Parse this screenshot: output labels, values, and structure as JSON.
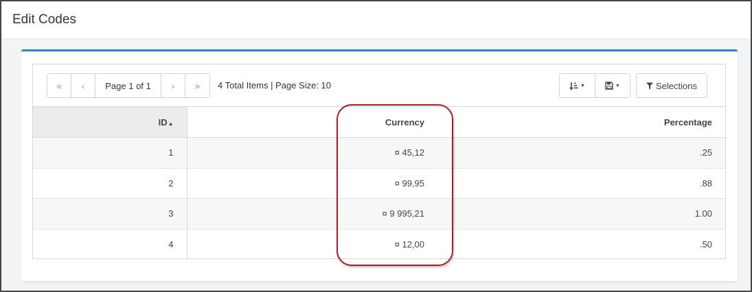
{
  "page": {
    "title": "Edit Codes"
  },
  "pager": {
    "first_icon": "«",
    "prev_icon": "‹",
    "info": "Page 1 of 1",
    "next_icon": "›",
    "last_icon": "»",
    "summary": "4 Total Items | Page Size: 10"
  },
  "toolbar": {
    "sort_icon": "sort-amount-icon",
    "save_icon": "floppy-disk-icon",
    "selections_label": "Selections",
    "selections_icon": "filter-icon"
  },
  "table": {
    "columns": [
      "ID",
      "Currency",
      "Percentage"
    ],
    "sorted_column": "ID",
    "sort_direction": "ascending",
    "rows": [
      {
        "id": "1",
        "currency": "¤ 45,12",
        "percentage": ".25"
      },
      {
        "id": "2",
        "currency": "¤ 99,95",
        "percentage": ".88"
      },
      {
        "id": "3",
        "currency": "¤ 9 995,21",
        "percentage": "1.00"
      },
      {
        "id": "4",
        "currency": "¤ 12,00",
        "percentage": ".50"
      }
    ]
  },
  "annotation": {
    "highlight_color": "#a81d2a"
  },
  "colors": {
    "accent": "#3c7fb1"
  }
}
